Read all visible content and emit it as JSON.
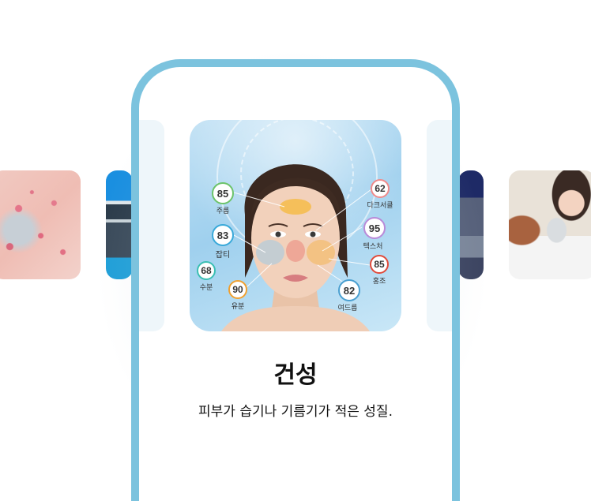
{
  "carousel": {
    "active_card": {
      "title": "건성",
      "description": "피부가 습기나 기름기가 적은 성질."
    },
    "skin_scores": [
      {
        "key": "wrinkle",
        "value": "85",
        "label": "주름",
        "color": "#6cc36a"
      },
      {
        "key": "blemish",
        "value": "83",
        "label": "잡티",
        "color": "#39a9d9"
      },
      {
        "key": "moisture",
        "value": "68",
        "label": "수분",
        "color": "#3bbfb3"
      },
      {
        "key": "oil",
        "value": "90",
        "label": "유분",
        "color": "#f0a030"
      },
      {
        "key": "dark-circle",
        "value": "62",
        "label": "다크서클",
        "color": "#f08a8a"
      },
      {
        "key": "texture",
        "value": "95",
        "label": "텍스처",
        "color": "#b98ad8"
      },
      {
        "key": "redness",
        "value": "85",
        "label": "홍조",
        "color": "#e04a3a"
      },
      {
        "key": "acne",
        "value": "82",
        "label": "여드름",
        "color": "#4a9fd0"
      }
    ]
  },
  "colors": {
    "phone_frame": "#7cc3de",
    "accent_bg": "#eef6fa"
  }
}
